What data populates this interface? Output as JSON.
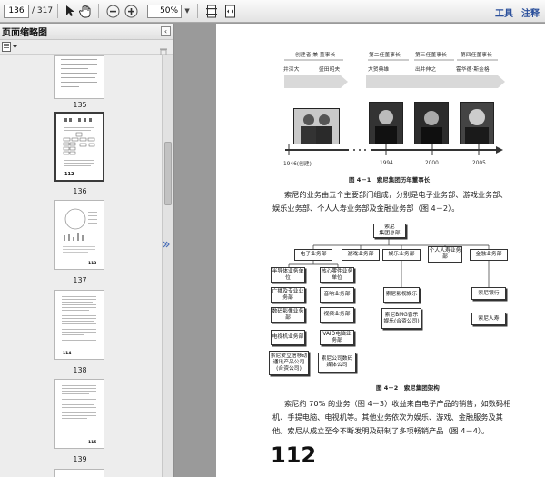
{
  "toolbar": {
    "current_page": "136",
    "total_pages": "/ 317",
    "zoom": "50%",
    "tools_label": "工具",
    "comment_label": "注释"
  },
  "sidebar": {
    "title": "页面缩略图",
    "pages": [
      "135",
      "136",
      "137",
      "138",
      "139"
    ]
  },
  "document": {
    "timeline": {
      "founders_label": "创建者 兼 董事长",
      "founder_1": "井深大",
      "founder_2": "盛田昭夫",
      "second_label": "第二任董事长",
      "second_name": "大贺典雄",
      "third_label": "第三任董事长",
      "third_name": "出井伸之",
      "fourth_label": "第四任董事长",
      "fourth_name": "霍华德·斯金格",
      "year_founded": "1946(创建)",
      "year_1": "1994",
      "year_2": "2000",
      "year_3": "2005"
    },
    "figure_1_caption": "图 4－1　索尼集团历年董事长",
    "paragraph_1": [
      "索尼的业务由五个主要部门组成，分别是电子业务部、游戏业务部、",
      "娱乐业务部、个人人寿业务部及金融业务部（图 4－2）。"
    ],
    "org": {
      "root": [
        "索尼",
        "集团总部"
      ],
      "level1": [
        "电子业务部",
        "游戏业务部",
        "娱乐业务部",
        "个人人寿业务部",
        "金融业务部"
      ],
      "electronics_left": [
        "半导体业务单位",
        "广播及专业业务部",
        "数码影像业务部",
        "电视机业务部",
        "索尼爱立信移动通讯产品公司(合资公司)"
      ],
      "electronics_right": [
        "核心零件业务单位",
        "音响业务部",
        "视频业务部",
        "VAIO电脑业务部",
        "索尼公司数码媒体公司"
      ],
      "entertainment": [
        "索尼影视娱乐",
        "索尼BMG音乐娱乐(合资公司)"
      ],
      "finance": [
        "索尼银行",
        "索尼人寿"
      ]
    },
    "figure_2_caption": "图 4－2　索尼集团架构",
    "paragraph_2": [
      "索尼约 70% 的业务（图 4－3）收益来自电子产品的销售，如数码相",
      "机、手提电脑、电视机等。其他业务依次为娱乐、游戏、金融服务及其",
      "他。索尼从成立至今不断发明及研制了多项畅销产品（图 4－4）。"
    ],
    "page_number": "112"
  },
  "icons": [
    "select-arrow-icon",
    "hand-tool-icon",
    "zoom-out-icon",
    "zoom-in-icon",
    "fit-page-icon",
    "fit-width-icon",
    "options-icon",
    "trash-icon",
    "collapse-icon"
  ]
}
